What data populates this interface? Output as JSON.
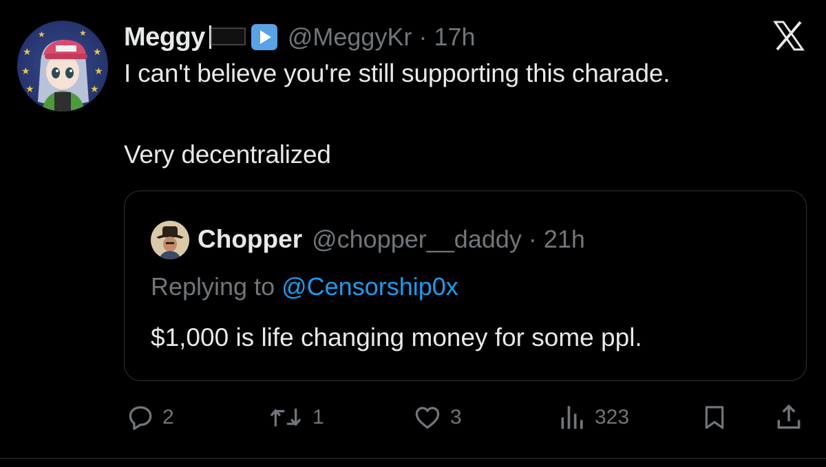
{
  "tweet": {
    "author": {
      "display_name": "Meggy",
      "handle_time": "@MeggyKr · 17h",
      "avatar_icon": "anime-avatar-icon"
    },
    "text_line1": "I can't believe you're still supporting this charade.",
    "text_line2": "Very decentralized"
  },
  "quoted_tweet": {
    "display_name": "Chopper",
    "handle_time": "@chopper__daddy · 21h",
    "replying_prefix": "Replying to ",
    "replying_mention": "@Censorship0x",
    "text": "$1,000 is life changing money for some ppl."
  },
  "actions": {
    "replies": "2",
    "reposts": "1",
    "likes": "3",
    "views": "323"
  },
  "colors": {
    "background": "#000000",
    "text": "#e7e9ea",
    "muted": "#71767b",
    "link": "#1d9bf0",
    "border": "#2f3336"
  }
}
